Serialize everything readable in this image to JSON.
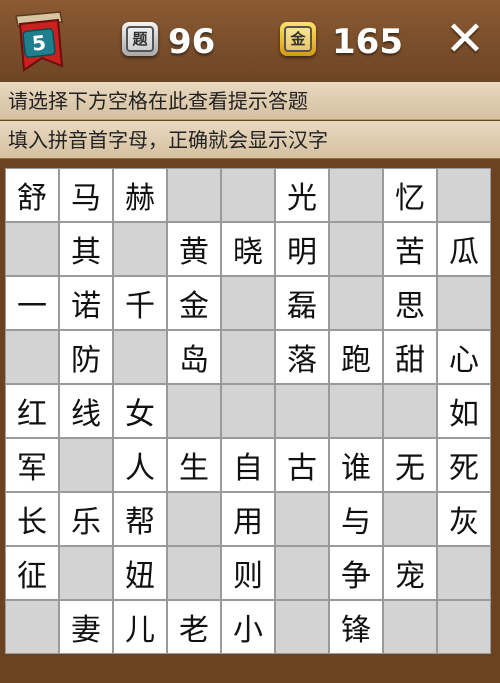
{
  "header": {
    "level": "5",
    "question_icon_label": "题",
    "question_count": "96",
    "gold_icon_label": "金",
    "gold_count": "165",
    "close_label": "✕"
  },
  "hints": {
    "line1": "请选择下方空格在此查看提示答题",
    "line2": "填入拼音首字母，正确就会显示汉字"
  },
  "board": {
    "rows": [
      [
        "舒",
        "马",
        "赫",
        "",
        "",
        "光",
        "",
        "忆",
        ""
      ],
      [
        "",
        "其",
        "",
        "黄",
        "晓",
        "明",
        "",
        "苦",
        "瓜"
      ],
      [
        "一",
        "诺",
        "千",
        "金",
        "",
        "磊",
        "",
        "思",
        ""
      ],
      [
        "",
        "防",
        "",
        "岛",
        "",
        "落",
        "跑",
        "甜",
        "心"
      ],
      [
        "红",
        "线",
        "女",
        "",
        "",
        "",
        "",
        "",
        "如"
      ],
      [
        "军",
        "",
        "人",
        "生",
        "自",
        "古",
        "谁",
        "无",
        "死"
      ],
      [
        "长",
        "乐",
        "帮",
        "",
        "用",
        "",
        "与",
        "",
        "灰"
      ],
      [
        "征",
        "",
        "妞",
        "",
        "则",
        "",
        "争",
        "宠",
        ""
      ],
      [
        "",
        "妻",
        "儿",
        "老",
        "小",
        "",
        "锋",
        "",
        ""
      ]
    ]
  }
}
